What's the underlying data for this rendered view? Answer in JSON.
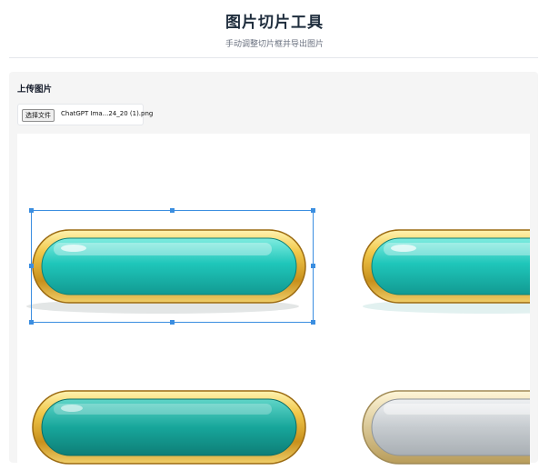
{
  "header": {
    "title": "图片切片工具",
    "subtitle": "手动调整切片框并导出图片"
  },
  "upload": {
    "section_title": "上传图片",
    "choose_file_label": "选择文件",
    "file_name": "ChatGPT Ima...24_20 (1).png"
  },
  "canvas": {
    "image_alt": "game button sprite sheet",
    "selection_color": "#3b8ee0"
  },
  "colors": {
    "gold": "#e7b73a",
    "teal": "#20c8bd",
    "silver": "#cfd3d6"
  }
}
